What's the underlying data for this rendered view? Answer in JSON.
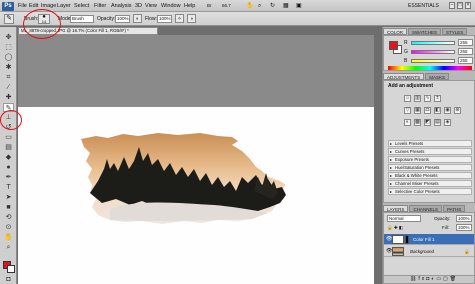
{
  "app": {
    "logo": "Ps",
    "menu": [
      "File",
      "Edit",
      "Image",
      "Layer",
      "Select",
      "Filter",
      "Analysis",
      "3D",
      "View",
      "Window",
      "Help"
    ],
    "zoom_readout": "66.7",
    "workspace": "ESSENTIALS",
    "window_controls": [
      "–",
      "□",
      "×"
    ]
  },
  "options_bar": {
    "brush_label": "Brush:",
    "brush_size": "14",
    "mode_label": "Mode:",
    "mode_value": "Brush",
    "opacity_label": "Opacity:",
    "opacity_value": "100%",
    "flow_label": "Flow:",
    "flow_value": "100%"
  },
  "document": {
    "tab_title": "ML_8878-cropped.JPG @ 16.7% (Color Fill 1, RGB/8*) *"
  },
  "color_panel": {
    "tabs": [
      "COLOR",
      "SWATCHES",
      "STYLES"
    ],
    "channels": [
      {
        "label": "R",
        "value": "255",
        "color": "#e0151b"
      },
      {
        "label": "G",
        "value": "255",
        "color": "#22aa33"
      },
      {
        "label": "B",
        "value": "255",
        "color": "#2244cc"
      }
    ]
  },
  "adjustments_panel": {
    "tabs": [
      "ADJUSTMENTS",
      "MASKS"
    ],
    "heading": "Add an adjustment",
    "presets": [
      "Levels Presets",
      "Curves Presets",
      "Exposure Presets",
      "Hue/Saturation Presets",
      "Black & White Presets",
      "Channel Mixer Presets",
      "Selective Color Presets"
    ]
  },
  "layers_panel": {
    "tabs": [
      "LAYERS",
      "CHANNELS",
      "PATHS"
    ],
    "blend_mode": "Normal",
    "opacity_label": "Opacity:",
    "opacity_value": "100%",
    "fill_label": "Fill:",
    "fill_value": "100%",
    "layers": [
      {
        "name": "Color Fill 1",
        "selected": true
      },
      {
        "name": "Background",
        "selected": false
      }
    ]
  },
  "colors": {
    "foreground": "#e0151b",
    "background": "#ffffff",
    "annotation": "#e01010",
    "selected_layer": "#3a6fb7"
  },
  "icons": [
    "brush-tool-icon",
    "eye-icon",
    "search-icon",
    "hand-icon",
    "zoom-icon",
    "move-icon",
    "marquee-icon",
    "lasso-icon",
    "crop-icon",
    "eyedropper-icon"
  ]
}
